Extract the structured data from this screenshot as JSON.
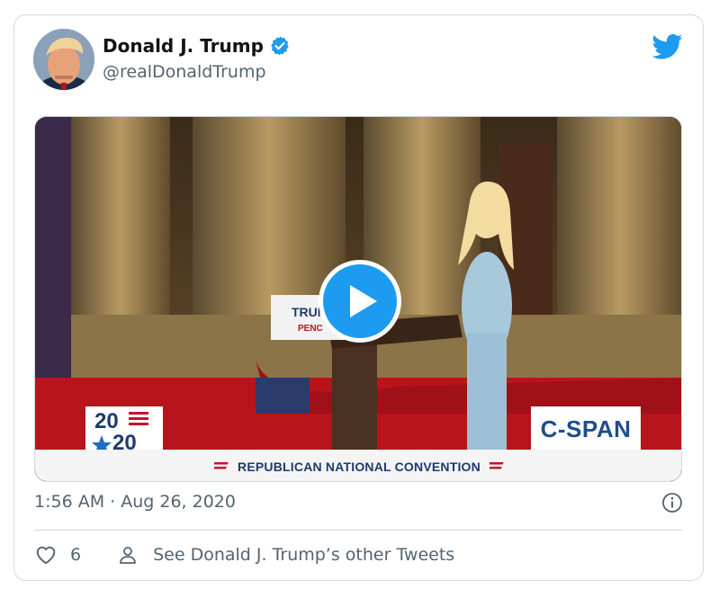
{
  "tweet": {
    "author_name": "Donald J. Trump",
    "handle": "@realDonaldTrump",
    "timestamp": "1:56 AM · Aug 26, 2020",
    "likes": "6",
    "see_more": "See Donald J. Trump’s other Tweets"
  },
  "video": {
    "logo_year_top": "20",
    "logo_year_bottom": "20",
    "network": "C-SPAN",
    "banner": "REPUBLICAN NATIONAL CONVENTION",
    "podium_sign_line1": "TRUM",
    "podium_sign_line2": "PENC"
  },
  "icons": {
    "verified": "verified-badge-icon",
    "brand": "twitter-bird-icon",
    "play": "play-icon",
    "info": "info-icon",
    "like": "heart-icon",
    "profile": "person-icon"
  },
  "colors": {
    "accent": "#1d9bf0",
    "text": "#0f1419",
    "muted": "#536471",
    "border": "#cfd9de"
  }
}
